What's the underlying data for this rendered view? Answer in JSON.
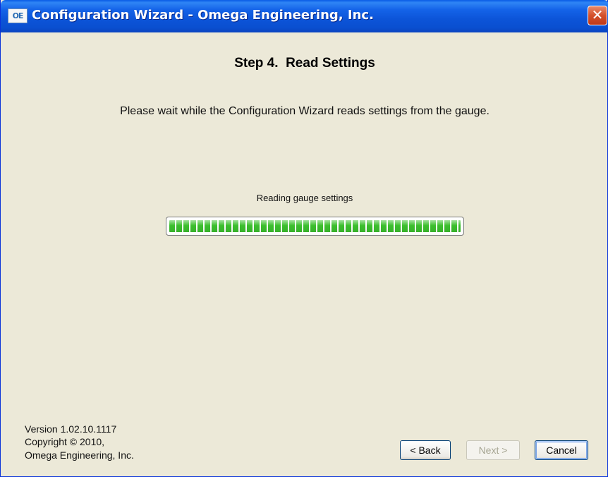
{
  "window": {
    "title": "Configuration Wizard - Omega Engineering, Inc.",
    "app_icon_glyph": "OE",
    "close_glyph": "✕",
    "accent_color": "#0a5ce5"
  },
  "step": {
    "title": "Step 4.  Read Settings",
    "instruction": "Please wait while the Configuration Wizard reads settings from the gauge."
  },
  "progress": {
    "label": "Reading gauge settings",
    "percent": 100,
    "fill_color": "#3cbf2e"
  },
  "footer": {
    "version": "Version 1.02.10.1117",
    "copyright": "Copyright © 2010,",
    "company": "Omega Engineering, Inc."
  },
  "buttons": {
    "back": "< Back",
    "next": "Next >",
    "cancel": "Cancel"
  }
}
